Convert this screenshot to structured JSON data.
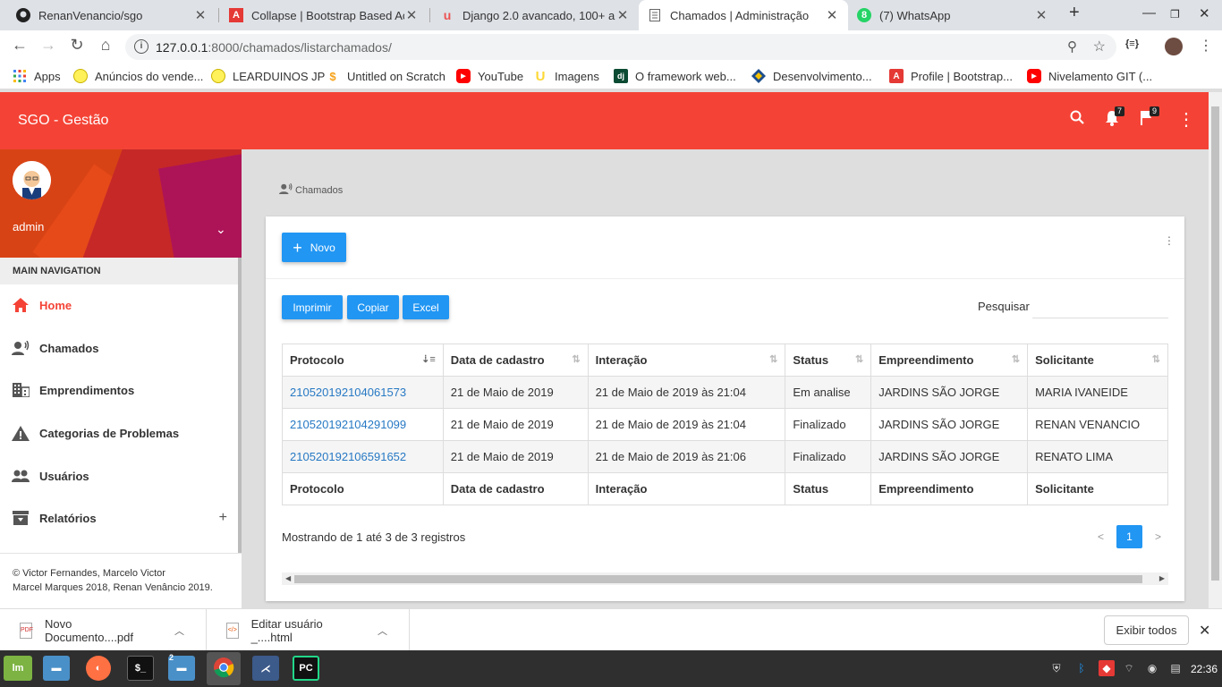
{
  "browser": {
    "tabs": [
      {
        "title": "RenanVenancio/sgo",
        "icon": "github-icon"
      },
      {
        "title": "Collapse | Bootstrap Based Ac",
        "icon": "adminbsb-icon"
      },
      {
        "title": "Django 2.0 avancado, 100+ au",
        "icon": "udemy-icon"
      },
      {
        "title": "Chamados | Administração",
        "icon": "page-icon"
      },
      {
        "title": "(7) WhatsApp",
        "icon": "whatsapp-icon"
      }
    ],
    "active_tab": 3,
    "url_host": "127.0.0.1",
    "url_rest": ":8000/chamados/listarchamados/",
    "bookmarks": [
      {
        "label": "Apps",
        "icon": "apps-grid-icon"
      },
      {
        "label": "Anúncios do vende...",
        "icon": "mercadolivre-icon"
      },
      {
        "label": "LEARDUINOS JP",
        "icon": "mercadolivre-icon"
      },
      {
        "label": "Untitled on Scratch",
        "icon": "scratch-icon"
      },
      {
        "label": "YouTube",
        "icon": "youtube-icon"
      },
      {
        "label": "Imagens",
        "icon": "u-logo-icon"
      },
      {
        "label": "O framework web...",
        "icon": "django-icon"
      },
      {
        "label": "Desenvolvimento...",
        "icon": "diamond-icon"
      },
      {
        "label": "Profile | Bootstrap...",
        "icon": "adminbsb-icon"
      },
      {
        "label": "Nivelamento GIT (...",
        "icon": "youtube-icon"
      }
    ]
  },
  "header": {
    "brand": "SGO - Gestão",
    "notifications_count": "7",
    "flags_count": "9",
    "accent": "#f44336"
  },
  "sidebar": {
    "username": "admin",
    "nav_heading": "MAIN NAVIGATION",
    "items": [
      {
        "label": "Home",
        "icon": "home-icon",
        "active": true
      },
      {
        "label": "Chamados",
        "icon": "record-voice-icon"
      },
      {
        "label": "Emprendimentos",
        "icon": "business-icon"
      },
      {
        "label": "Categorias de Problemas",
        "icon": "warning-icon"
      },
      {
        "label": "Usuários",
        "icon": "people-icon"
      },
      {
        "label": "Relatórios",
        "icon": "archive-icon",
        "expand": "+"
      }
    ],
    "footer_line1": "© Victor Fernandes, Marcelo Victor",
    "footer_line2": "Marcel Marques 2018, Renan Venâncio 2019."
  },
  "main": {
    "breadcrumb": "Chamados",
    "new_button": "Novo",
    "export_buttons": [
      "Imprimir",
      "Copiar",
      "Excel"
    ],
    "search_label": "Pesquisar",
    "search_value": "",
    "columns": [
      "Protocolo",
      "Data de cadastro",
      "Interação",
      "Status",
      "Empreendimento",
      "Solicitante"
    ],
    "rows": [
      [
        "210520192104061573",
        "21 de Maio de 2019",
        "21 de Maio de 2019 às 21:04",
        "Em analise",
        "JARDINS SÃO JORGE",
        "MARIA IVANEIDE"
      ],
      [
        "210520192104291099",
        "21 de Maio de 2019",
        "21 de Maio de 2019 às 21:04",
        "Finalizado",
        "JARDINS SÃO JORGE",
        "RENAN VENANCIO"
      ],
      [
        "210520192106591652",
        "21 de Maio de 2019",
        "21 de Maio de 2019 às 21:06",
        "Finalizado",
        "JARDINS SÃO JORGE",
        "RENATO LIMA"
      ]
    ],
    "info": "Mostrando de 1 até 3 de 3 registros",
    "page_prev": "<",
    "page_current": "1",
    "page_next": ">"
  },
  "downloads": {
    "items": [
      "Novo Documento....pdf",
      "Editar usuário _....html"
    ],
    "show_all": "Exibir todos"
  },
  "taskbar": {
    "clock": "22:36",
    "folder_badge": "2"
  }
}
